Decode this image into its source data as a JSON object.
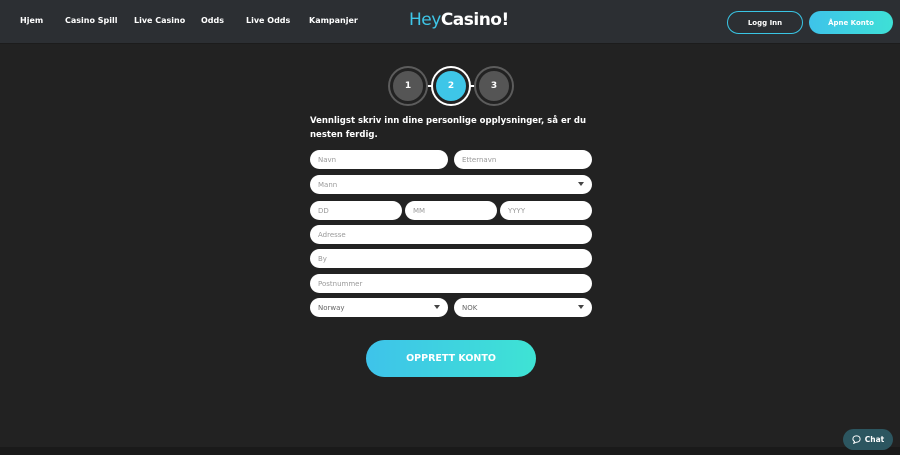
{
  "nav": {
    "items": [
      "Hjem",
      "Casino Spill",
      "Live Casino",
      "Odds",
      "Live Odds",
      "Kampanjer"
    ]
  },
  "logo": {
    "part1": "Hey",
    "part2": "Casino!"
  },
  "header": {
    "login_label": "Logg Inn",
    "open_account_label": "Åpne Konto"
  },
  "stepper": {
    "steps": [
      "1",
      "2",
      "3"
    ],
    "active_step": 2
  },
  "form": {
    "intro": "Vennligst skriv inn dine personlige opplysninger, så er du nesten ferdig.",
    "first_name_placeholder": "Navn",
    "last_name_placeholder": "Etternavn",
    "gender_value": "Mann",
    "day_placeholder": "DD",
    "month_placeholder": "MM",
    "year_placeholder": "YYYY",
    "address_placeholder": "Adresse",
    "city_placeholder": "By",
    "postcode_placeholder": "Postnummer",
    "country_value": "Norway",
    "currency_value": "NOK",
    "submit_label": "OPPRETT KONTO"
  },
  "chat": {
    "label": "Chat"
  },
  "colors": {
    "accent": "#3ec6e8",
    "background": "#222222",
    "header": "#2c2f33"
  }
}
